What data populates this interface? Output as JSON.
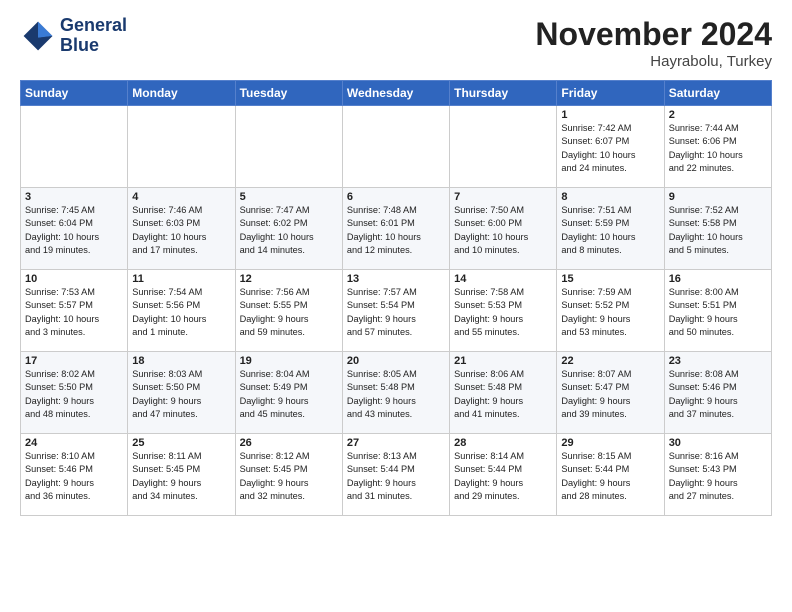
{
  "logo": {
    "line1": "General",
    "line2": "Blue"
  },
  "title": "November 2024",
  "location": "Hayrabolu, Turkey",
  "days_header": [
    "Sunday",
    "Monday",
    "Tuesday",
    "Wednesday",
    "Thursday",
    "Friday",
    "Saturday"
  ],
  "weeks": [
    [
      {
        "day": "",
        "info": ""
      },
      {
        "day": "",
        "info": ""
      },
      {
        "day": "",
        "info": ""
      },
      {
        "day": "",
        "info": ""
      },
      {
        "day": "",
        "info": ""
      },
      {
        "day": "1",
        "info": "Sunrise: 7:42 AM\nSunset: 6:07 PM\nDaylight: 10 hours\nand 24 minutes."
      },
      {
        "day": "2",
        "info": "Sunrise: 7:44 AM\nSunset: 6:06 PM\nDaylight: 10 hours\nand 22 minutes."
      }
    ],
    [
      {
        "day": "3",
        "info": "Sunrise: 7:45 AM\nSunset: 6:04 PM\nDaylight: 10 hours\nand 19 minutes."
      },
      {
        "day": "4",
        "info": "Sunrise: 7:46 AM\nSunset: 6:03 PM\nDaylight: 10 hours\nand 17 minutes."
      },
      {
        "day": "5",
        "info": "Sunrise: 7:47 AM\nSunset: 6:02 PM\nDaylight: 10 hours\nand 14 minutes."
      },
      {
        "day": "6",
        "info": "Sunrise: 7:48 AM\nSunset: 6:01 PM\nDaylight: 10 hours\nand 12 minutes."
      },
      {
        "day": "7",
        "info": "Sunrise: 7:50 AM\nSunset: 6:00 PM\nDaylight: 10 hours\nand 10 minutes."
      },
      {
        "day": "8",
        "info": "Sunrise: 7:51 AM\nSunset: 5:59 PM\nDaylight: 10 hours\nand 8 minutes."
      },
      {
        "day": "9",
        "info": "Sunrise: 7:52 AM\nSunset: 5:58 PM\nDaylight: 10 hours\nand 5 minutes."
      }
    ],
    [
      {
        "day": "10",
        "info": "Sunrise: 7:53 AM\nSunset: 5:57 PM\nDaylight: 10 hours\nand 3 minutes."
      },
      {
        "day": "11",
        "info": "Sunrise: 7:54 AM\nSunset: 5:56 PM\nDaylight: 10 hours\nand 1 minute."
      },
      {
        "day": "12",
        "info": "Sunrise: 7:56 AM\nSunset: 5:55 PM\nDaylight: 9 hours\nand 59 minutes."
      },
      {
        "day": "13",
        "info": "Sunrise: 7:57 AM\nSunset: 5:54 PM\nDaylight: 9 hours\nand 57 minutes."
      },
      {
        "day": "14",
        "info": "Sunrise: 7:58 AM\nSunset: 5:53 PM\nDaylight: 9 hours\nand 55 minutes."
      },
      {
        "day": "15",
        "info": "Sunrise: 7:59 AM\nSunset: 5:52 PM\nDaylight: 9 hours\nand 53 minutes."
      },
      {
        "day": "16",
        "info": "Sunrise: 8:00 AM\nSunset: 5:51 PM\nDaylight: 9 hours\nand 50 minutes."
      }
    ],
    [
      {
        "day": "17",
        "info": "Sunrise: 8:02 AM\nSunset: 5:50 PM\nDaylight: 9 hours\nand 48 minutes."
      },
      {
        "day": "18",
        "info": "Sunrise: 8:03 AM\nSunset: 5:50 PM\nDaylight: 9 hours\nand 47 minutes."
      },
      {
        "day": "19",
        "info": "Sunrise: 8:04 AM\nSunset: 5:49 PM\nDaylight: 9 hours\nand 45 minutes."
      },
      {
        "day": "20",
        "info": "Sunrise: 8:05 AM\nSunset: 5:48 PM\nDaylight: 9 hours\nand 43 minutes."
      },
      {
        "day": "21",
        "info": "Sunrise: 8:06 AM\nSunset: 5:48 PM\nDaylight: 9 hours\nand 41 minutes."
      },
      {
        "day": "22",
        "info": "Sunrise: 8:07 AM\nSunset: 5:47 PM\nDaylight: 9 hours\nand 39 minutes."
      },
      {
        "day": "23",
        "info": "Sunrise: 8:08 AM\nSunset: 5:46 PM\nDaylight: 9 hours\nand 37 minutes."
      }
    ],
    [
      {
        "day": "24",
        "info": "Sunrise: 8:10 AM\nSunset: 5:46 PM\nDaylight: 9 hours\nand 36 minutes."
      },
      {
        "day": "25",
        "info": "Sunrise: 8:11 AM\nSunset: 5:45 PM\nDaylight: 9 hours\nand 34 minutes."
      },
      {
        "day": "26",
        "info": "Sunrise: 8:12 AM\nSunset: 5:45 PM\nDaylight: 9 hours\nand 32 minutes."
      },
      {
        "day": "27",
        "info": "Sunrise: 8:13 AM\nSunset: 5:44 PM\nDaylight: 9 hours\nand 31 minutes."
      },
      {
        "day": "28",
        "info": "Sunrise: 8:14 AM\nSunset: 5:44 PM\nDaylight: 9 hours\nand 29 minutes."
      },
      {
        "day": "29",
        "info": "Sunrise: 8:15 AM\nSunset: 5:44 PM\nDaylight: 9 hours\nand 28 minutes."
      },
      {
        "day": "30",
        "info": "Sunrise: 8:16 AM\nSunset: 5:43 PM\nDaylight: 9 hours\nand 27 minutes."
      }
    ]
  ]
}
